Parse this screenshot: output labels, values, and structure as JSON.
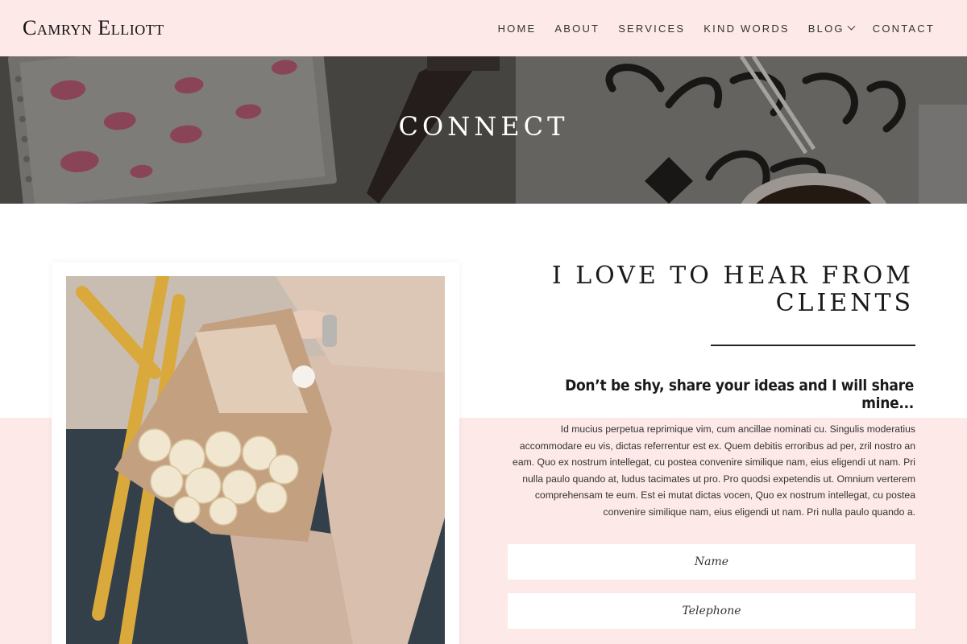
{
  "header": {
    "logo": "Camryn Elliott",
    "nav": [
      {
        "label": "HOME"
      },
      {
        "label": "ABOUT"
      },
      {
        "label": "SERVICES"
      },
      {
        "label": "KIND WORDS"
      },
      {
        "label": "BLOG",
        "has_dropdown": true
      },
      {
        "label": "CONTACT"
      }
    ]
  },
  "hero": {
    "title": "CONNECT",
    "image_icon": "desk-flatlay-image"
  },
  "main": {
    "heading_line1": "I LOVE TO HEAR FROM",
    "heading_line2": "CLIENTS",
    "subheading": "Don’t be shy, share your ideas and I will share mine...",
    "body": "Id mucius perpetua reprimique vim, cum ancillae nominati cu. Singulis moderatius accommodare eu vis, dictas referrentur est ex. Quem debitis erroribus ad per, zril nostro an eam. Quo ex nostrum intellegat, cu postea convenire similique nam, eius eligendi ut nam. Pri nulla paulo quando at, ludus tacimates ut pro. Pro quodsi expetendis ut. Omnium verterem comprehensam te eum. Est ei mutat dictas vocen, Quo ex nostrum intellegat, cu postea convenire similique nam, eius eligendi ut nam. Pri nulla paulo quando a.",
    "photo_icon": "woman-with-flower-bouquet-image"
  },
  "form": {
    "name_placeholder": "Name",
    "telephone_placeholder": "Telephone"
  },
  "colors": {
    "pink_background": "#fde9e7",
    "text_dark": "#1a1a1a"
  }
}
